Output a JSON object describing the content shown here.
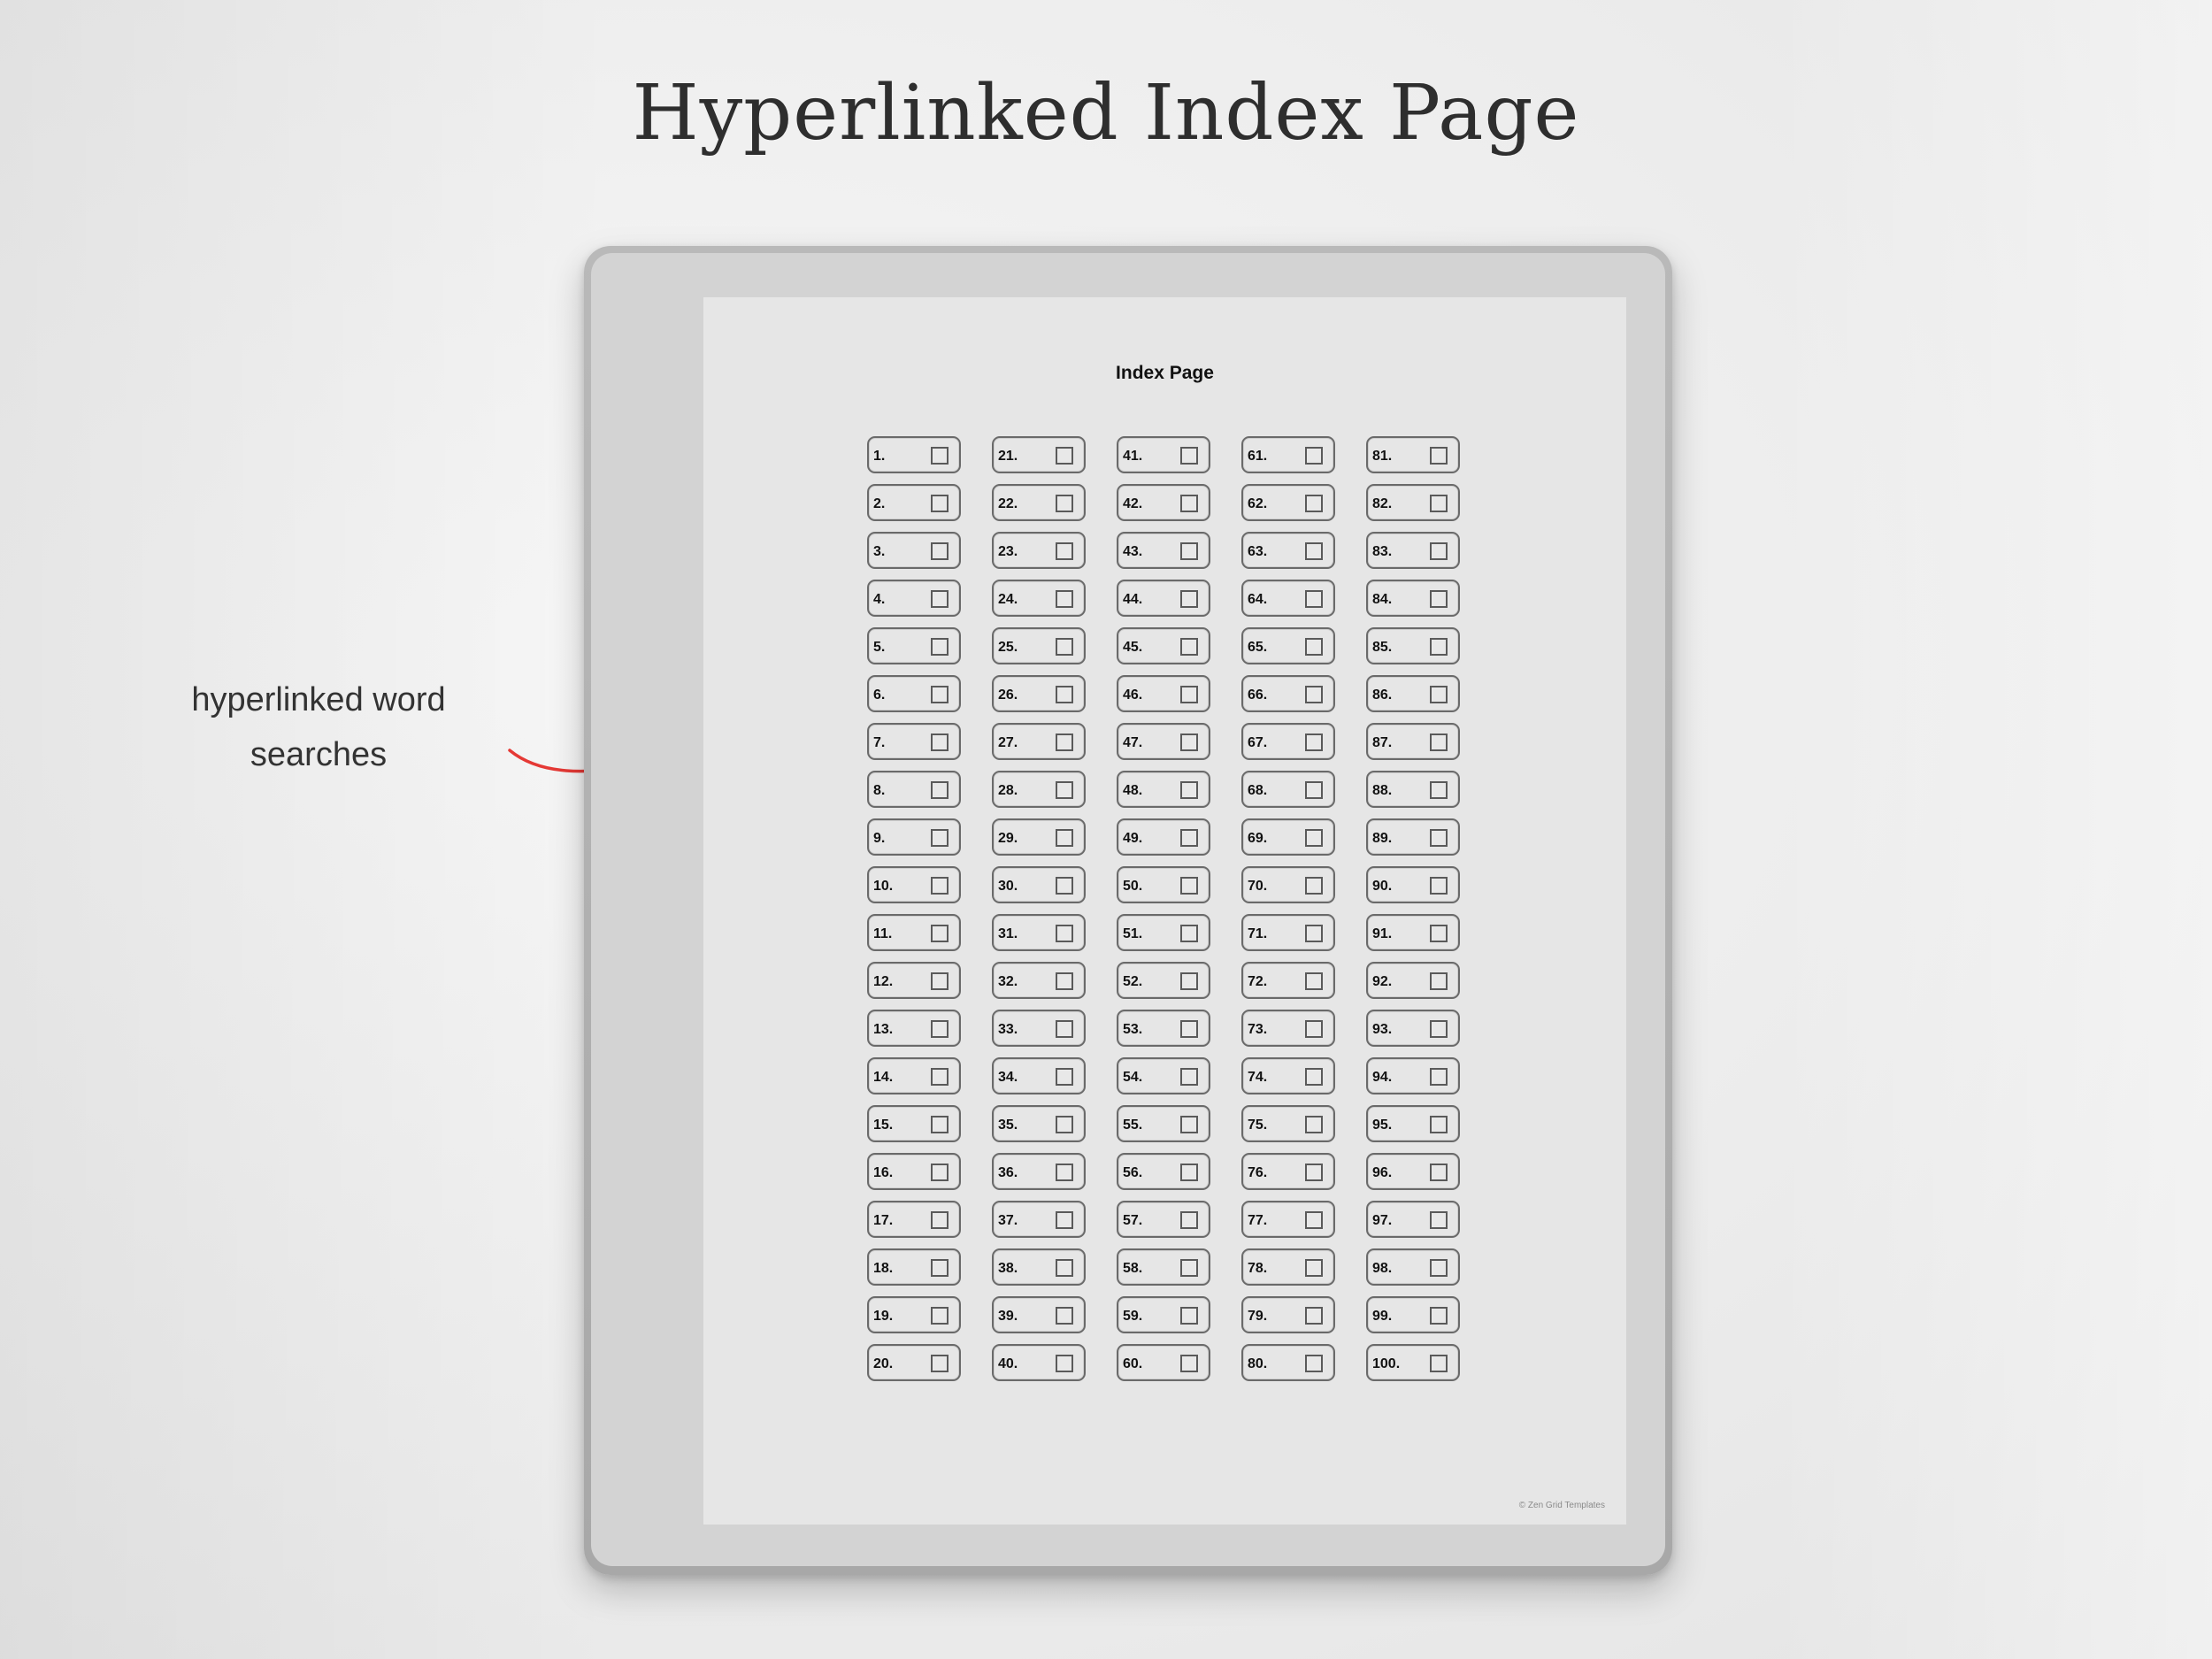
{
  "header": {
    "title": "Hyperlinked Index Page"
  },
  "callout": {
    "line1": "hyperlinked word",
    "line2": "searches",
    "arrow_color": "#e53935"
  },
  "device": {
    "screen": {
      "title": "Index Page",
      "entries": [
        "1.",
        "2.",
        "3.",
        "4.",
        "5.",
        "6.",
        "7.",
        "8.",
        "9.",
        "10.",
        "11.",
        "12.",
        "13.",
        "14.",
        "15.",
        "16.",
        "17.",
        "18.",
        "19.",
        "20.",
        "21.",
        "22.",
        "23.",
        "24.",
        "25.",
        "26.",
        "27.",
        "28.",
        "29.",
        "30.",
        "31.",
        "32.",
        "33.",
        "34.",
        "35.",
        "36.",
        "37.",
        "38.",
        "39.",
        "40.",
        "41.",
        "42.",
        "43.",
        "44.",
        "45.",
        "46.",
        "47.",
        "48.",
        "49.",
        "50.",
        "51.",
        "52.",
        "53.",
        "54.",
        "55.",
        "56.",
        "57.",
        "58.",
        "59.",
        "60.",
        "61.",
        "62.",
        "63.",
        "64.",
        "65.",
        "66.",
        "67.",
        "68.",
        "69.",
        "70.",
        "71.",
        "72.",
        "73.",
        "74.",
        "75.",
        "76.",
        "77.",
        "78.",
        "79.",
        "80.",
        "81.",
        "82.",
        "83.",
        "84.",
        "85.",
        "86.",
        "87.",
        "88.",
        "89.",
        "90.",
        "91.",
        "92.",
        "93.",
        "94.",
        "95.",
        "96.",
        "97.",
        "98.",
        "99.",
        "100."
      ],
      "footer": "© Zen Grid Templates"
    }
  }
}
